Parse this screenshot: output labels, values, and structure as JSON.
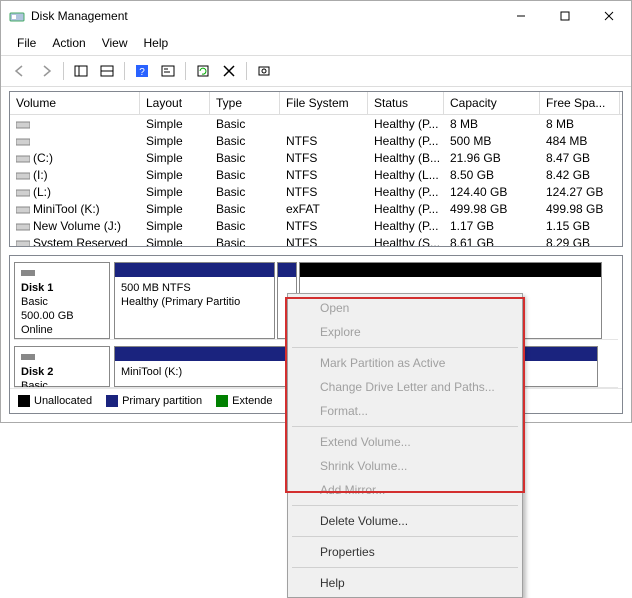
{
  "window": {
    "title": "Disk Management"
  },
  "menubar": [
    "File",
    "Action",
    "View",
    "Help"
  ],
  "toolbar_icons": [
    "back-icon",
    "forward-icon",
    "sep",
    "show-hide-icon",
    "show-hide2-icon",
    "sep",
    "help-icon",
    "console-icon",
    "sep",
    "refresh-icon",
    "delete-icon",
    "sep",
    "settings-icon"
  ],
  "columns": [
    {
      "key": "volume",
      "label": "Volume"
    },
    {
      "key": "layout",
      "label": "Layout"
    },
    {
      "key": "type",
      "label": "Type"
    },
    {
      "key": "fs",
      "label": "File System"
    },
    {
      "key": "status",
      "label": "Status"
    },
    {
      "key": "cap",
      "label": "Capacity"
    },
    {
      "key": "free",
      "label": "Free Spa..."
    }
  ],
  "volumes": [
    {
      "volume": "",
      "layout": "Simple",
      "type": "Basic",
      "fs": "",
      "status": "Healthy (P...",
      "cap": "8 MB",
      "free": "8 MB"
    },
    {
      "volume": "",
      "layout": "Simple",
      "type": "Basic",
      "fs": "NTFS",
      "status": "Healthy (P...",
      "cap": "500 MB",
      "free": "484 MB"
    },
    {
      "volume": "(C:)",
      "layout": "Simple",
      "type": "Basic",
      "fs": "NTFS",
      "status": "Healthy (B...",
      "cap": "21.96 GB",
      "free": "8.47 GB"
    },
    {
      "volume": "(I:)",
      "layout": "Simple",
      "type": "Basic",
      "fs": "NTFS",
      "status": "Healthy (L...",
      "cap": "8.50 GB",
      "free": "8.42 GB"
    },
    {
      "volume": "(L:)",
      "layout": "Simple",
      "type": "Basic",
      "fs": "NTFS",
      "status": "Healthy (P...",
      "cap": "124.40 GB",
      "free": "124.27 GB"
    },
    {
      "volume": "MiniTool (K:)",
      "layout": "Simple",
      "type": "Basic",
      "fs": "exFAT",
      "status": "Healthy (P...",
      "cap": "499.98 GB",
      "free": "499.98 GB"
    },
    {
      "volume": "New Volume (J:)",
      "layout": "Simple",
      "type": "Basic",
      "fs": "NTFS",
      "status": "Healthy (P...",
      "cap": "1.17 GB",
      "free": "1.15 GB"
    },
    {
      "volume": "System Reserved",
      "layout": "Simple",
      "type": "Basic",
      "fs": "NTFS",
      "status": "Healthy (S...",
      "cap": "8.61 GB",
      "free": "8.29 GB"
    }
  ],
  "disks": {
    "d1": {
      "name": "Disk 1",
      "type": "Basic",
      "size": "500.00 GB",
      "state": "Online",
      "parts": [
        {
          "stripe": "blue",
          "width": "32%",
          "line1": "500 MB NTFS",
          "line2": "Healthy (Primary Partitio"
        },
        {
          "stripe": "blue",
          "width": "4%",
          "line1": "",
          "line2": ""
        },
        {
          "stripe": "black",
          "width": "60%",
          "line1": "",
          "line2": ""
        }
      ]
    },
    "d2": {
      "name": "Disk 2",
      "type": "Basic",
      "size": "",
      "state": "",
      "parts": [
        {
          "stripe": "blue",
          "width": "96%",
          "line1": "MiniTool (K:)",
          "line2": ""
        }
      ]
    }
  },
  "legend": [
    {
      "color": "#000",
      "label": "Unallocated"
    },
    {
      "color": "#1a237e",
      "label": "Primary partition"
    },
    {
      "color": "#008000",
      "label": "Extende"
    }
  ],
  "context_menu": [
    {
      "label": "Open",
      "enabled": false
    },
    {
      "label": "Explore",
      "enabled": false
    },
    {
      "sep": true
    },
    {
      "label": "Mark Partition as Active",
      "enabled": false
    },
    {
      "label": "Change Drive Letter and Paths...",
      "enabled": false
    },
    {
      "label": "Format...",
      "enabled": false
    },
    {
      "sep": true
    },
    {
      "label": "Extend Volume...",
      "enabled": false
    },
    {
      "label": "Shrink Volume...",
      "enabled": false
    },
    {
      "label": "Add Mirror...",
      "enabled": false
    },
    {
      "sep": true
    },
    {
      "label": "Delete Volume...",
      "enabled": true
    },
    {
      "sep": true
    },
    {
      "label": "Properties",
      "enabled": true
    },
    {
      "sep": true
    },
    {
      "label": "Help",
      "enabled": true
    }
  ]
}
